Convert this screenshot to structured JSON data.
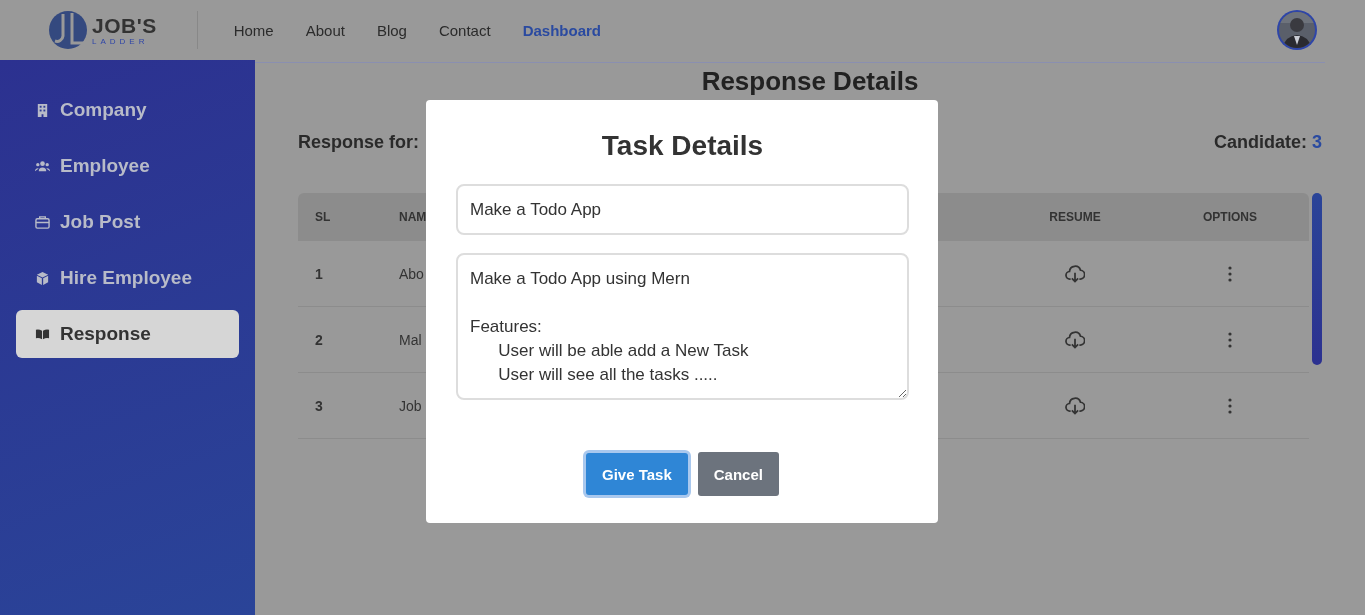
{
  "header": {
    "logo": {
      "title": "JOB'S",
      "subtitle": "LADDER"
    },
    "nav": [
      {
        "label": "Home",
        "selected": false
      },
      {
        "label": "About",
        "selected": false
      },
      {
        "label": "Blog",
        "selected": false
      },
      {
        "label": "Contact",
        "selected": false
      },
      {
        "label": "Dashboard",
        "selected": true
      }
    ]
  },
  "sidebar": {
    "items": [
      {
        "label": "Company",
        "selected": false
      },
      {
        "label": "Employee",
        "selected": false
      },
      {
        "label": "Job Post",
        "selected": false
      },
      {
        "label": "Hire Employee",
        "selected": false
      },
      {
        "label": "Response",
        "selected": true
      }
    ]
  },
  "page": {
    "title": "Response Details",
    "response_for": "Response for:",
    "candidate_label": "Candidate:",
    "candidate_count": "3"
  },
  "table": {
    "columns": [
      "SL",
      "NAM",
      "RESUME",
      "OPTIONS"
    ],
    "rows": [
      {
        "sl": "1",
        "name": "Abo"
      },
      {
        "sl": "2",
        "name": "Mal"
      },
      {
        "sl": "3",
        "name": "Job"
      }
    ]
  },
  "modal": {
    "title": "Task Details",
    "task_title": "Make a Todo App",
    "task_description": "Make a Todo App using Mern\n\nFeatures:\n      User will be able add a New Task\n      User will see all the tasks .....",
    "buttons": [
      {
        "label": "Give Task",
        "kind": "primary"
      },
      {
        "label": "Cancel",
        "kind": "secondary"
      }
    ]
  }
}
